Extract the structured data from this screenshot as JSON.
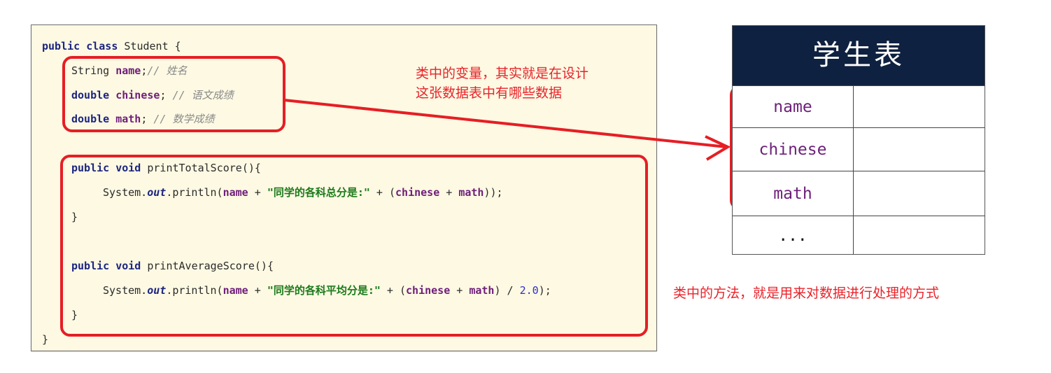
{
  "code": {
    "class_decl": {
      "kw": "public class",
      "name": " Student {"
    },
    "field_name": {
      "type": "String ",
      "name": "name",
      "semi": ";",
      "comment": "// 姓名"
    },
    "field_chinese": {
      "kw": "double",
      "name": "chinese",
      "semi": "; ",
      "comment": "// 语文成绩"
    },
    "field_math": {
      "kw": "double",
      "name": "math",
      "semi": "; ",
      "comment": "// 数学成绩"
    },
    "method1": {
      "decl_kw": "public void",
      "decl_rest": " printTotalScore(){",
      "body": {
        "p1": "System.",
        "out": "out",
        "p2": ".println(",
        "name": "name",
        "p3": " + ",
        "str": "\"同学的各科总分是:\"",
        "p4": " + (",
        "chinese": "chinese",
        "p5": " + ",
        "math": "math",
        "p6": "));"
      },
      "close": "}"
    },
    "method2": {
      "decl_kw": "public void",
      "decl_rest": " printAverageScore(){",
      "body": {
        "p1": "System.",
        "out": "out",
        "p2": ".println(",
        "name": "name",
        "p3": " + ",
        "str": "\"同学的各科平均分是:\"",
        "p4": " + (",
        "chinese": "chinese",
        "p5": " + ",
        "math": "math",
        "p6": ") / ",
        "num": "2.0",
        "p7": ");"
      },
      "close": "}"
    },
    "class_close": "}"
  },
  "annotations": {
    "variables_note_line1": "类中的变量，其实就是在设计",
    "variables_note_line2": "这张数据表中有哪些数据",
    "methods_note": "类中的方法，就是用来对数据进行处理的方式"
  },
  "table": {
    "title": "学生表",
    "rows": [
      "name",
      "chinese",
      "math",
      "..."
    ]
  },
  "colors": {
    "highlight_red": "#e61e24",
    "table_header_bg": "#0f2140",
    "code_bg": "#fdf9e3"
  }
}
